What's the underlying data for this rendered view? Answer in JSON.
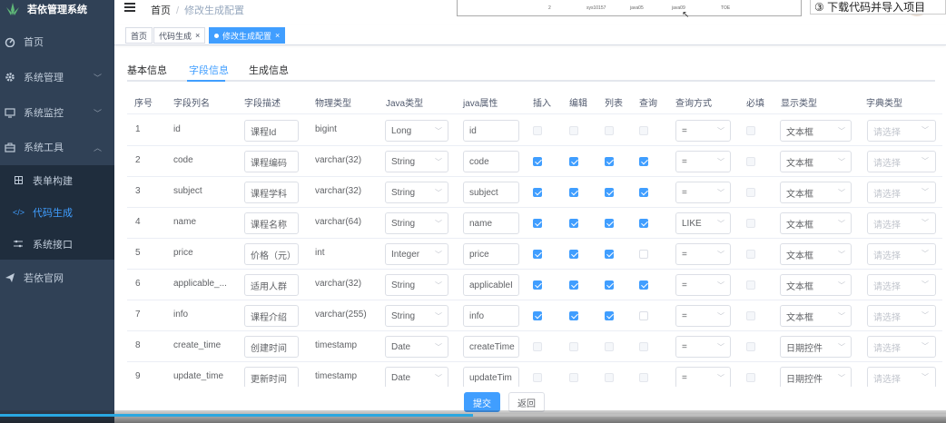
{
  "app": {
    "title": "若依管理系统"
  },
  "sidebar": {
    "items": [
      {
        "label": "首页",
        "icon": "dashboard-icon"
      },
      {
        "label": "系统管理",
        "icon": "gear-icon",
        "arrow": "﹀"
      },
      {
        "label": "系统监控",
        "icon": "monitor-icon",
        "arrow": "﹀"
      },
      {
        "label": "系统工具",
        "icon": "toolbox-icon",
        "arrow": "︿"
      },
      {
        "label": "若依官网",
        "icon": "send-icon"
      }
    ],
    "submenu": [
      {
        "label": "表单构建",
        "icon": "grid-icon"
      },
      {
        "label": "代码生成",
        "icon": "code-icon"
      },
      {
        "label": "系统接口",
        "icon": "sliders-icon"
      }
    ]
  },
  "header": {
    "breadcrumb": [
      "首页",
      "修改生成配置"
    ],
    "separator": "/",
    "hint": "③  下载代码并导入项目",
    "strip": [
      "2",
      "sys10157",
      "java05",
      "java09",
      "TOE"
    ]
  },
  "tags": [
    {
      "label": "首页"
    },
    {
      "label": "代码生成",
      "close": "×"
    },
    {
      "label": "修改生成配置",
      "close": "×"
    }
  ],
  "tabs": [
    "基本信息",
    "字段信息",
    "生成信息"
  ],
  "table": {
    "headers": [
      "序号",
      "字段列名",
      "字段描述",
      "物理类型",
      "Java类型",
      "java属性",
      "插入",
      "编辑",
      "列表",
      "查询",
      "查询方式",
      "必填",
      "显示类型",
      "字典类型"
    ],
    "placeholder_dict": "请选择",
    "rows": [
      {
        "no": "1",
        "col": "id",
        "desc": "课程Id",
        "phys": "bigint",
        "jtype": "Long",
        "jprop": "id",
        "ins": false,
        "edit": false,
        "list": false,
        "query": false,
        "qway": "=",
        "req": false,
        "show": "文本框",
        "disabled": true
      },
      {
        "no": "2",
        "col": "code",
        "desc": "课程编码",
        "phys": "varchar(32)",
        "jtype": "String",
        "jprop": "code",
        "ins": true,
        "edit": true,
        "list": true,
        "query": true,
        "qway": "=",
        "req": false,
        "show": "文本框"
      },
      {
        "no": "3",
        "col": "subject",
        "desc": "课程学科",
        "phys": "varchar(32)",
        "jtype": "String",
        "jprop": "subject",
        "ins": true,
        "edit": true,
        "list": true,
        "query": true,
        "qway": "=",
        "req": false,
        "show": "文本框"
      },
      {
        "no": "4",
        "col": "name",
        "desc": "课程名称",
        "phys": "varchar(64)",
        "jtype": "String",
        "jprop": "name",
        "ins": true,
        "edit": true,
        "list": true,
        "query": true,
        "qway": "LIKE",
        "req": false,
        "show": "文本框"
      },
      {
        "no": "5",
        "col": "price",
        "desc": "价格（元）",
        "phys": "int",
        "jtype": "Integer",
        "jprop": "price",
        "ins": true,
        "edit": true,
        "list": true,
        "query": false,
        "qway": "=",
        "req": false,
        "show": "文本框"
      },
      {
        "no": "6",
        "col": "applicable_...",
        "desc": "适用人群",
        "phys": "varchar(32)",
        "jtype": "String",
        "jprop": "applicableI",
        "ins": true,
        "edit": true,
        "list": true,
        "query": true,
        "qway": "=",
        "req": false,
        "show": "文本框"
      },
      {
        "no": "7",
        "col": "info",
        "desc": "课程介绍",
        "phys": "varchar(255)",
        "jtype": "String",
        "jprop": "info",
        "ins": true,
        "edit": true,
        "list": true,
        "query": false,
        "qway": "=",
        "req": false,
        "show": "文本框"
      },
      {
        "no": "8",
        "col": "create_time",
        "desc": "创建时间",
        "phys": "timestamp",
        "jtype": "Date",
        "jprop": "createTime",
        "ins": false,
        "edit": false,
        "list": false,
        "query": false,
        "qway": "=",
        "req": false,
        "show": "日期控件",
        "disabled": true
      },
      {
        "no": "9",
        "col": "update_time",
        "desc": "更新时间",
        "phys": "timestamp",
        "jtype": "Date",
        "jprop": "updateTim",
        "ins": false,
        "edit": false,
        "list": false,
        "query": false,
        "qway": "=",
        "req": false,
        "show": "日期控件",
        "disabled": true
      }
    ]
  },
  "footer": {
    "submit": "提交",
    "back": "返回"
  },
  "video": {
    "progress_fraction": 0.5
  },
  "colors": {
    "primary": "#409eff",
    "sidebar": "#304156",
    "submenu": "#1f2d3d"
  }
}
